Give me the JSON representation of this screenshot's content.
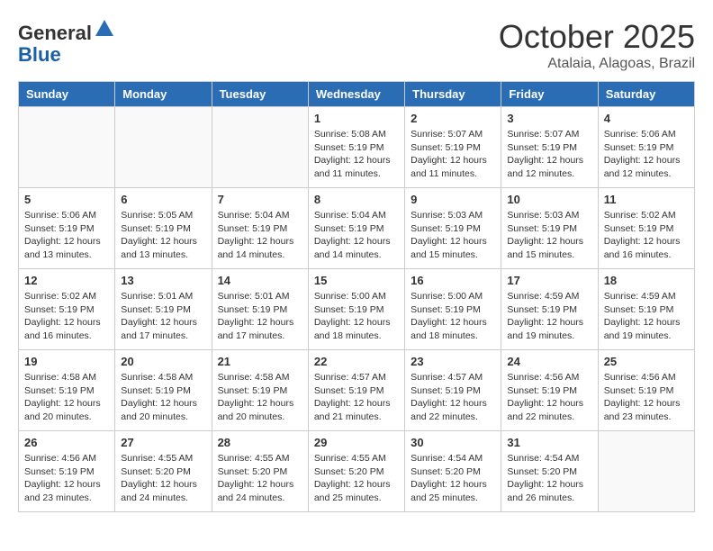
{
  "header": {
    "logo_general": "General",
    "logo_blue": "Blue",
    "month_title": "October 2025",
    "location": "Atalaia, Alagoas, Brazil"
  },
  "weekdays": [
    "Sunday",
    "Monday",
    "Tuesday",
    "Wednesday",
    "Thursday",
    "Friday",
    "Saturday"
  ],
  "weeks": [
    [
      {
        "day": "",
        "sunrise": "",
        "sunset": "",
        "daylight": ""
      },
      {
        "day": "",
        "sunrise": "",
        "sunset": "",
        "daylight": ""
      },
      {
        "day": "",
        "sunrise": "",
        "sunset": "",
        "daylight": ""
      },
      {
        "day": "1",
        "sunrise": "Sunrise: 5:08 AM",
        "sunset": "Sunset: 5:19 PM",
        "daylight": "Daylight: 12 hours and 11 minutes."
      },
      {
        "day": "2",
        "sunrise": "Sunrise: 5:07 AM",
        "sunset": "Sunset: 5:19 PM",
        "daylight": "Daylight: 12 hours and 11 minutes."
      },
      {
        "day": "3",
        "sunrise": "Sunrise: 5:07 AM",
        "sunset": "Sunset: 5:19 PM",
        "daylight": "Daylight: 12 hours and 12 minutes."
      },
      {
        "day": "4",
        "sunrise": "Sunrise: 5:06 AM",
        "sunset": "Sunset: 5:19 PM",
        "daylight": "Daylight: 12 hours and 12 minutes."
      }
    ],
    [
      {
        "day": "5",
        "sunrise": "Sunrise: 5:06 AM",
        "sunset": "Sunset: 5:19 PM",
        "daylight": "Daylight: 12 hours and 13 minutes."
      },
      {
        "day": "6",
        "sunrise": "Sunrise: 5:05 AM",
        "sunset": "Sunset: 5:19 PM",
        "daylight": "Daylight: 12 hours and 13 minutes."
      },
      {
        "day": "7",
        "sunrise": "Sunrise: 5:04 AM",
        "sunset": "Sunset: 5:19 PM",
        "daylight": "Daylight: 12 hours and 14 minutes."
      },
      {
        "day": "8",
        "sunrise": "Sunrise: 5:04 AM",
        "sunset": "Sunset: 5:19 PM",
        "daylight": "Daylight: 12 hours and 14 minutes."
      },
      {
        "day": "9",
        "sunrise": "Sunrise: 5:03 AM",
        "sunset": "Sunset: 5:19 PM",
        "daylight": "Daylight: 12 hours and 15 minutes."
      },
      {
        "day": "10",
        "sunrise": "Sunrise: 5:03 AM",
        "sunset": "Sunset: 5:19 PM",
        "daylight": "Daylight: 12 hours and 15 minutes."
      },
      {
        "day": "11",
        "sunrise": "Sunrise: 5:02 AM",
        "sunset": "Sunset: 5:19 PM",
        "daylight": "Daylight: 12 hours and 16 minutes."
      }
    ],
    [
      {
        "day": "12",
        "sunrise": "Sunrise: 5:02 AM",
        "sunset": "Sunset: 5:19 PM",
        "daylight": "Daylight: 12 hours and 16 minutes."
      },
      {
        "day": "13",
        "sunrise": "Sunrise: 5:01 AM",
        "sunset": "Sunset: 5:19 PM",
        "daylight": "Daylight: 12 hours and 17 minutes."
      },
      {
        "day": "14",
        "sunrise": "Sunrise: 5:01 AM",
        "sunset": "Sunset: 5:19 PM",
        "daylight": "Daylight: 12 hours and 17 minutes."
      },
      {
        "day": "15",
        "sunrise": "Sunrise: 5:00 AM",
        "sunset": "Sunset: 5:19 PM",
        "daylight": "Daylight: 12 hours and 18 minutes."
      },
      {
        "day": "16",
        "sunrise": "Sunrise: 5:00 AM",
        "sunset": "Sunset: 5:19 PM",
        "daylight": "Daylight: 12 hours and 18 minutes."
      },
      {
        "day": "17",
        "sunrise": "Sunrise: 4:59 AM",
        "sunset": "Sunset: 5:19 PM",
        "daylight": "Daylight: 12 hours and 19 minutes."
      },
      {
        "day": "18",
        "sunrise": "Sunrise: 4:59 AM",
        "sunset": "Sunset: 5:19 PM",
        "daylight": "Daylight: 12 hours and 19 minutes."
      }
    ],
    [
      {
        "day": "19",
        "sunrise": "Sunrise: 4:58 AM",
        "sunset": "Sunset: 5:19 PM",
        "daylight": "Daylight: 12 hours and 20 minutes."
      },
      {
        "day": "20",
        "sunrise": "Sunrise: 4:58 AM",
        "sunset": "Sunset: 5:19 PM",
        "daylight": "Daylight: 12 hours and 20 minutes."
      },
      {
        "day": "21",
        "sunrise": "Sunrise: 4:58 AM",
        "sunset": "Sunset: 5:19 PM",
        "daylight": "Daylight: 12 hours and 20 minutes."
      },
      {
        "day": "22",
        "sunrise": "Sunrise: 4:57 AM",
        "sunset": "Sunset: 5:19 PM",
        "daylight": "Daylight: 12 hours and 21 minutes."
      },
      {
        "day": "23",
        "sunrise": "Sunrise: 4:57 AM",
        "sunset": "Sunset: 5:19 PM",
        "daylight": "Daylight: 12 hours and 22 minutes."
      },
      {
        "day": "24",
        "sunrise": "Sunrise: 4:56 AM",
        "sunset": "Sunset: 5:19 PM",
        "daylight": "Daylight: 12 hours and 22 minutes."
      },
      {
        "day": "25",
        "sunrise": "Sunrise: 4:56 AM",
        "sunset": "Sunset: 5:19 PM",
        "daylight": "Daylight: 12 hours and 23 minutes."
      }
    ],
    [
      {
        "day": "26",
        "sunrise": "Sunrise: 4:56 AM",
        "sunset": "Sunset: 5:19 PM",
        "daylight": "Daylight: 12 hours and 23 minutes."
      },
      {
        "day": "27",
        "sunrise": "Sunrise: 4:55 AM",
        "sunset": "Sunset: 5:20 PM",
        "daylight": "Daylight: 12 hours and 24 minutes."
      },
      {
        "day": "28",
        "sunrise": "Sunrise: 4:55 AM",
        "sunset": "Sunset: 5:20 PM",
        "daylight": "Daylight: 12 hours and 24 minutes."
      },
      {
        "day": "29",
        "sunrise": "Sunrise: 4:55 AM",
        "sunset": "Sunset: 5:20 PM",
        "daylight": "Daylight: 12 hours and 25 minutes."
      },
      {
        "day": "30",
        "sunrise": "Sunrise: 4:54 AM",
        "sunset": "Sunset: 5:20 PM",
        "daylight": "Daylight: 12 hours and 25 minutes."
      },
      {
        "day": "31",
        "sunrise": "Sunrise: 4:54 AM",
        "sunset": "Sunset: 5:20 PM",
        "daylight": "Daylight: 12 hours and 26 minutes."
      },
      {
        "day": "",
        "sunrise": "",
        "sunset": "",
        "daylight": ""
      }
    ]
  ]
}
